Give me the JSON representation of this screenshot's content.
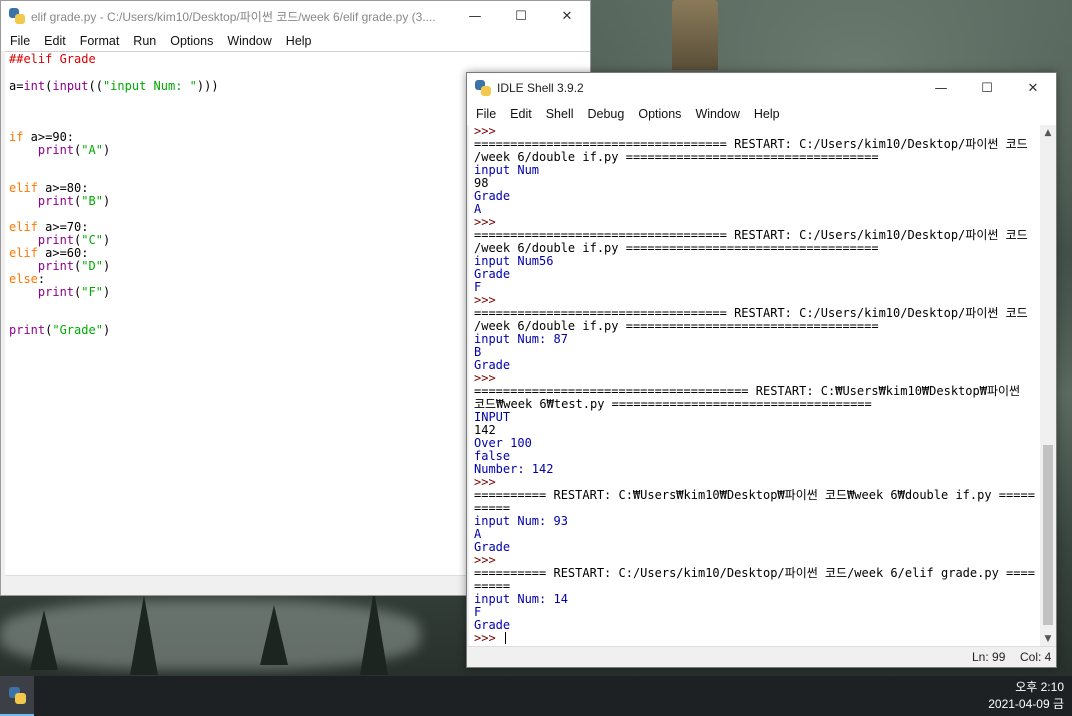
{
  "editor": {
    "title": "elif grade.py - C:/Users/kim10/Desktop/파이썬 코드/week 6/elif grade.py (3....",
    "menu": [
      "File",
      "Edit",
      "Format",
      "Run",
      "Options",
      "Window",
      "Help"
    ],
    "code": [
      [
        {
          "t": "##elif Grade",
          "c": "c-comment"
        }
      ],
      [],
      [
        {
          "t": "a=",
          "c": "c-plain"
        },
        {
          "t": "int",
          "c": "c-builtin"
        },
        {
          "t": "(",
          "c": "c-plain"
        },
        {
          "t": "input",
          "c": "c-builtin"
        },
        {
          "t": "((",
          "c": "c-plain"
        },
        {
          "t": "\"input Num: \"",
          "c": "c-str"
        },
        {
          "t": ")))",
          "c": "c-plain"
        }
      ],
      [],
      [],
      [],
      [
        {
          "t": "if",
          "c": "c-kw"
        },
        {
          "t": " a>=90:",
          "c": "c-plain"
        }
      ],
      [
        {
          "t": "    ",
          "c": "c-plain"
        },
        {
          "t": "print",
          "c": "c-builtin"
        },
        {
          "t": "(",
          "c": "c-plain"
        },
        {
          "t": "\"A\"",
          "c": "c-str"
        },
        {
          "t": ")",
          "c": "c-plain"
        }
      ],
      [],
      [],
      [
        {
          "t": "elif",
          "c": "c-kw"
        },
        {
          "t": " a>=80:",
          "c": "c-plain"
        }
      ],
      [
        {
          "t": "    ",
          "c": "c-plain"
        },
        {
          "t": "print",
          "c": "c-builtin"
        },
        {
          "t": "(",
          "c": "c-plain"
        },
        {
          "t": "\"B\"",
          "c": "c-str"
        },
        {
          "t": ")",
          "c": "c-plain"
        }
      ],
      [],
      [
        {
          "t": "elif",
          "c": "c-kw"
        },
        {
          "t": " a>=70:",
          "c": "c-plain"
        }
      ],
      [
        {
          "t": "    ",
          "c": "c-plain"
        },
        {
          "t": "print",
          "c": "c-builtin"
        },
        {
          "t": "(",
          "c": "c-plain"
        },
        {
          "t": "\"C\"",
          "c": "c-str"
        },
        {
          "t": ")",
          "c": "c-plain"
        }
      ],
      [
        {
          "t": "elif",
          "c": "c-kw"
        },
        {
          "t": " a>=60:",
          "c": "c-plain"
        }
      ],
      [
        {
          "t": "    ",
          "c": "c-plain"
        },
        {
          "t": "print",
          "c": "c-builtin"
        },
        {
          "t": "(",
          "c": "c-plain"
        },
        {
          "t": "\"D\"",
          "c": "c-str"
        },
        {
          "t": ")",
          "c": "c-plain"
        }
      ],
      [
        {
          "t": "else",
          "c": "c-kw"
        },
        {
          "t": ":",
          "c": "c-plain"
        }
      ],
      [
        {
          "t": "    ",
          "c": "c-plain"
        },
        {
          "t": "print",
          "c": "c-builtin"
        },
        {
          "t": "(",
          "c": "c-plain"
        },
        {
          "t": "\"F\"",
          "c": "c-str"
        },
        {
          "t": ")",
          "c": "c-plain"
        }
      ],
      [],
      [],
      [
        {
          "t": "print",
          "c": "c-builtin"
        },
        {
          "t": "(",
          "c": "c-plain"
        },
        {
          "t": "\"Grade\"",
          "c": "c-str"
        },
        {
          "t": ")",
          "c": "c-plain"
        }
      ]
    ]
  },
  "shell": {
    "title": "IDLE Shell 3.9.2",
    "menu": [
      "File",
      "Edit",
      "Shell",
      "Debug",
      "Options",
      "Window",
      "Help"
    ],
    "lines": [
      {
        "t": ">>>",
        "c": "s-prompt"
      },
      {
        "t": "=================================== RESTART: C:/Users/kim10/Desktop/파이썬 코드",
        "c": "s-restart"
      },
      {
        "t": "/week 6/double if.py ===================================",
        "c": "s-restart"
      },
      {
        "t": "input Num",
        "c": "s-out"
      },
      {
        "t": "98",
        "c": "s-in"
      },
      {
        "t": "Grade",
        "c": "s-out"
      },
      {
        "t": "A",
        "c": "s-out"
      },
      {
        "t": ">>>",
        "c": "s-prompt"
      },
      {
        "t": "=================================== RESTART: C:/Users/kim10/Desktop/파이썬 코드",
        "c": "s-restart"
      },
      {
        "t": "/week 6/double if.py ===================================",
        "c": "s-restart"
      },
      {
        "t": "input Num56",
        "c": "s-out"
      },
      {
        "t": "Grade",
        "c": "s-out"
      },
      {
        "t": "F",
        "c": "s-out"
      },
      {
        "t": ">>>",
        "c": "s-prompt"
      },
      {
        "t": "=================================== RESTART: C:/Users/kim10/Desktop/파이썬 코드",
        "c": "s-restart"
      },
      {
        "t": "/week 6/double if.py ===================================",
        "c": "s-restart"
      },
      {
        "t": "input Num: 87",
        "c": "s-out"
      },
      {
        "t": "B",
        "c": "s-out"
      },
      {
        "t": "Grade",
        "c": "s-out"
      },
      {
        "t": ">>>",
        "c": "s-prompt"
      },
      {
        "t": "====================================== RESTART: C:₩Users₩kim10₩Desktop₩파이썬",
        "c": "s-restart"
      },
      {
        "t": "코드₩week 6₩test.py ====================================",
        "c": "s-restart"
      },
      {
        "t": "INPUT",
        "c": "s-out"
      },
      {
        "t": "142",
        "c": "s-in"
      },
      {
        "t": "Over 100",
        "c": "s-out"
      },
      {
        "t": "false",
        "c": "s-out"
      },
      {
        "t": "Number: 142",
        "c": "s-out"
      },
      {
        "t": ">>>",
        "c": "s-prompt"
      },
      {
        "t": "========== RESTART: C:₩Users₩kim10₩Desktop₩파이썬 코드₩week 6₩double if.py =====",
        "c": "s-restart"
      },
      {
        "t": "=====",
        "c": "s-restart"
      },
      {
        "t": "input Num: 93",
        "c": "s-out"
      },
      {
        "t": "A",
        "c": "s-out"
      },
      {
        "t": "Grade",
        "c": "s-out"
      },
      {
        "t": ">>>",
        "c": "s-prompt"
      },
      {
        "t": "========== RESTART: C:/Users/kim10/Desktop/파이썬 코드/week 6/elif grade.py ====",
        "c": "s-restart"
      },
      {
        "t": "=====",
        "c": "s-restart"
      },
      {
        "t": "input Num: 14",
        "c": "s-out"
      },
      {
        "t": "F",
        "c": "s-out"
      },
      {
        "t": "Grade",
        "c": "s-out"
      }
    ],
    "last_prompt": ">>> ",
    "status_ln": "Ln: 99",
    "status_col": "Col: 4"
  },
  "taskbar": {
    "time": "오후 2:10",
    "date": "2021-04-09 금"
  }
}
